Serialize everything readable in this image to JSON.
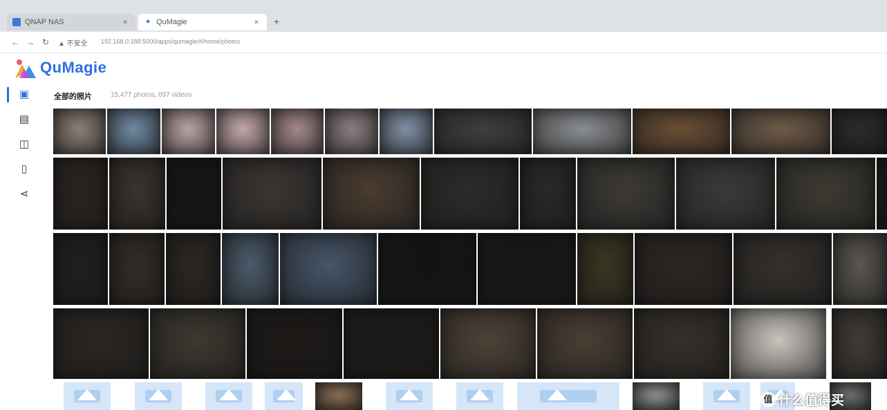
{
  "browser": {
    "tabs": [
      {
        "title": "QNAP NAS",
        "favicon": "nas-favicon",
        "active": false
      },
      {
        "title": "QuMagie",
        "favicon": "qumagie-favicon",
        "active": true
      }
    ],
    "new_tab_symbol": "+",
    "close_symbol": "✕",
    "address": {
      "security_label": "▲ 不安全",
      "url": "192.168.0.188:5000/apps/qumagie/#/home/photos"
    },
    "nav_icons": [
      "back-icon",
      "forward-icon",
      "reload-icon"
    ]
  },
  "app": {
    "title": "QuMagie",
    "brand_color": "#2d6fe0"
  },
  "sidebar": {
    "items": [
      {
        "icon": "photos-icon",
        "glyph": "▣",
        "active": true
      },
      {
        "icon": "calendar-icon",
        "glyph": "▤",
        "active": false
      },
      {
        "icon": "album-icon",
        "glyph": "◫",
        "active": false
      },
      {
        "icon": "phone-icon",
        "glyph": "▯",
        "active": false
      },
      {
        "icon": "share-icon",
        "glyph": "⋖",
        "active": false
      }
    ]
  },
  "main": {
    "album_title": "全部的照片",
    "album_count": "15,477 photos, 697 videos"
  },
  "photos": [
    {
      "c": "#8c7f75"
    },
    {
      "c": "#6f88a2"
    },
    {
      "c": "#b9a3a4"
    },
    {
      "c": "#c2a7a9"
    },
    {
      "c": "#a4878a"
    },
    {
      "c": "#8b7d80"
    },
    {
      "c": "#7e8ea4"
    },
    {
      "c": "#3e3e3e"
    },
    {
      "c": "#8a8d90"
    },
    {
      "c": "#6a4e35"
    },
    {
      "c": "#6e5a48"
    },
    {
      "c": "#2a2a2a"
    },
    {
      "c": "#2b2420"
    },
    {
      "c": "#3a332d"
    },
    {
      "c": "#141414"
    },
    {
      "c": "#3a3633"
    },
    {
      "c": "#4a3c30"
    },
    {
      "c": "#2d2b29"
    },
    {
      "c": "#2a2826"
    },
    {
      "c": "#3d3a36"
    },
    {
      "c": "#3b3a38"
    },
    {
      "c": "#3d3a32"
    },
    {
      "c": "#23211f"
    },
    {
      "c": "#1e1e1e"
    },
    {
      "c": "#312c26"
    },
    {
      "c": "#2b2620"
    },
    {
      "c": "#4a5a6b"
    },
    {
      "c": "#465569"
    },
    {
      "c": "#121212"
    },
    {
      "c": "#161616"
    },
    {
      "c": "#3a3520"
    },
    {
      "c": "#2c2622"
    },
    {
      "c": "#34302c"
    },
    {
      "c": "#5a5650"
    },
    {
      "c": "#2a2622"
    },
    {
      "c": "#3d3830"
    },
    {
      "c": "#1b1816"
    },
    {
      "c": "#1a1a18"
    },
    {
      "c": "#4e4237"
    },
    {
      "c": "#4a3e33"
    },
    {
      "c": "#36302a"
    },
    {
      "c": "#c9c4bd"
    },
    {
      "c": "#3f3a34"
    },
    {
      "c": "placeholder"
    },
    {
      "c": "placeholder"
    },
    {
      "c": "placeholder"
    },
    {
      "c": "placeholder"
    },
    {
      "c": "#8a6e55"
    },
    {
      "c": "placeholder"
    },
    {
      "c": "placeholder"
    },
    {
      "c": "placeholder"
    },
    {
      "c": "#8c8e90"
    },
    {
      "c": "placeholder"
    },
    {
      "c": "placeholder"
    },
    {
      "c": "#6e6e6e"
    }
  ],
  "watermark": {
    "badge": "值",
    "text": "什么值得买"
  }
}
